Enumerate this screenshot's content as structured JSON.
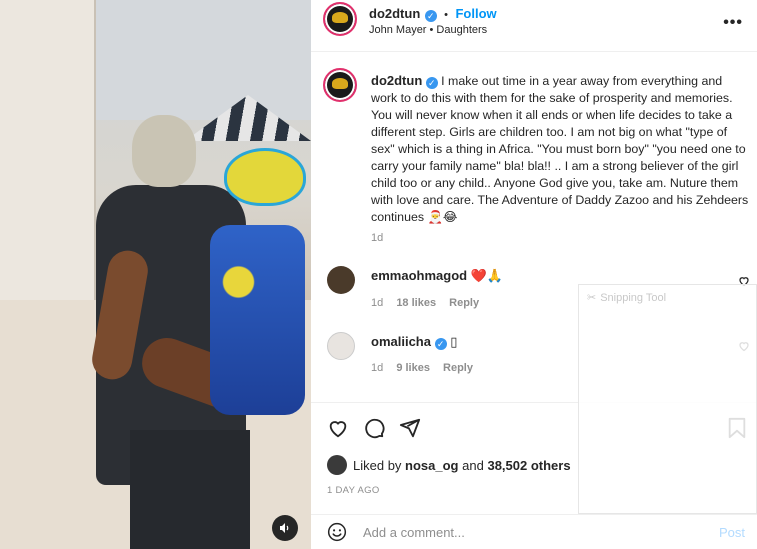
{
  "header": {
    "username": "do2dtun",
    "follow_label": "Follow",
    "dot": "•",
    "subtitle": "John Mayer • Daughters",
    "more_icon": "more-horizontal-icon"
  },
  "caption": {
    "username": "do2dtun",
    "text": "I make out time in a year away from everything and work to do this with them for the sake of prosperity and memories. You will never know when it all ends or when life decides to take a different step. Girls are children too. I am not big on what \"type of sex\" which is a thing in Africa. \"You must born boy\" \"you need one to carry your family name\" bla! bla!! .. I am a strong believer of the girl child too or any child.. Anyone God give you, take am. Nuture them with love and care. The Adventure of Daddy Zazoo and his Zehdeers continues 🎅😂",
    "time": "1d"
  },
  "comments": [
    {
      "username": "emmaohmagod",
      "text": "❤️🙏",
      "time": "1d",
      "likes": "18 likes",
      "reply": "Reply"
    },
    {
      "username": "omaliicha",
      "text": "▯",
      "time": "1d",
      "likes": "9 likes",
      "reply": "Reply"
    }
  ],
  "likes": {
    "liked_by": "Liked by",
    "user": "nosa_og",
    "and": "and",
    "others": "38,502 others"
  },
  "date": "1 DAY AGO",
  "add_comment": {
    "placeholder": "Add a comment...",
    "post_label": "Post"
  },
  "overlay": {
    "snipping_tool": "Snipping Tool"
  },
  "colors": {
    "accent": "#0095f6",
    "verified": "#3897f0",
    "heart": "#ed4956",
    "text": "#262626",
    "muted": "#8e8e8e"
  }
}
